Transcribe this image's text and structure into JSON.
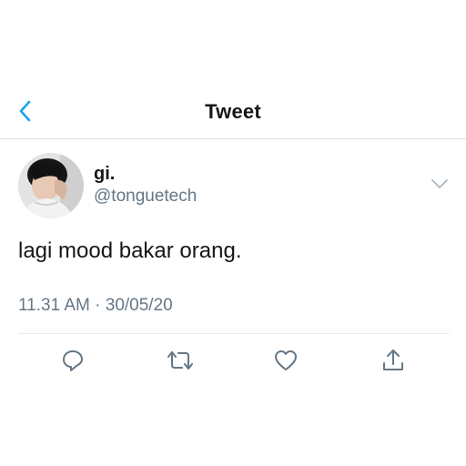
{
  "header": {
    "title": "Tweet",
    "back_icon": "chevron-left-icon"
  },
  "tweet": {
    "author_name": "gi.",
    "author_handle": "@tonguetech",
    "text": "lagi mood bakar orang.",
    "time": "11.31 AM",
    "separator": "·",
    "date": "30/05/20"
  },
  "actions": [
    "reply-icon",
    "retweet-icon",
    "like-icon",
    "share-icon"
  ],
  "colors": {
    "accent": "#1da1f2",
    "text_primary": "#14171a",
    "text_secondary": "#657786",
    "icon_gray": "#657786",
    "divider": "#e6ecf0"
  }
}
